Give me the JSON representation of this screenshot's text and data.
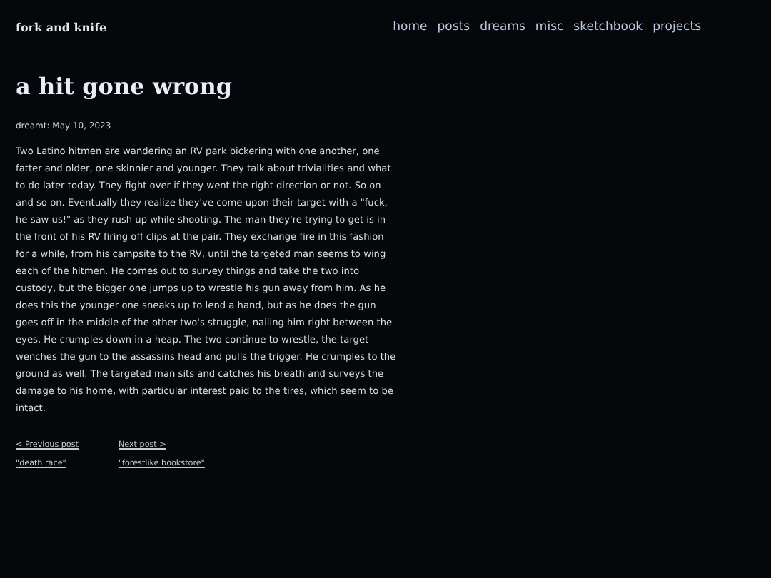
{
  "site_title": "fork and knife",
  "nav": [
    "home",
    "posts",
    "dreams",
    "misc",
    "sketchbook",
    "projects"
  ],
  "post": {
    "title": "a hit gone wrong",
    "meta": "dreamt: May 10, 2023",
    "body": "Two Latino hitmen are wandering an RV park bickering with one another, one fatter and older, one skinnier and younger. They talk about trivialities and what to do later today. They fight over if they went the right direction or not. So on and so on. Eventually they realize they've come upon their target with a \"fuck, he saw us!\" as they rush up while shooting. The man they're trying to get is in the front of his RV firing off clips at the pair. They exchange fire in this fashion for a while, from his campsite to the RV, until the targeted man seems to wing each of the hitmen. He comes out to survey things and take the two into custody, but the bigger one jumps up to wrestle his gun away from him. As he does this the younger one sneaks up to lend a hand, but as he does the gun goes off in the middle of the other two's struggle, nailing him right between the eyes. He crumples down in a heap. The two continue to wrestle, the target wenches the gun to the assassins head and pulls the trigger. He crumples to the ground as well. The targeted man sits and catches his breath and surveys the damage to his home, with particular interest paid to the tires, which seem to be intact."
  },
  "pager": [
    {
      "label": "< Previous post",
      "title": "\"death race\""
    },
    {
      "label": "Next post >",
      "title": "\"forestlike bookstore\""
    }
  ]
}
